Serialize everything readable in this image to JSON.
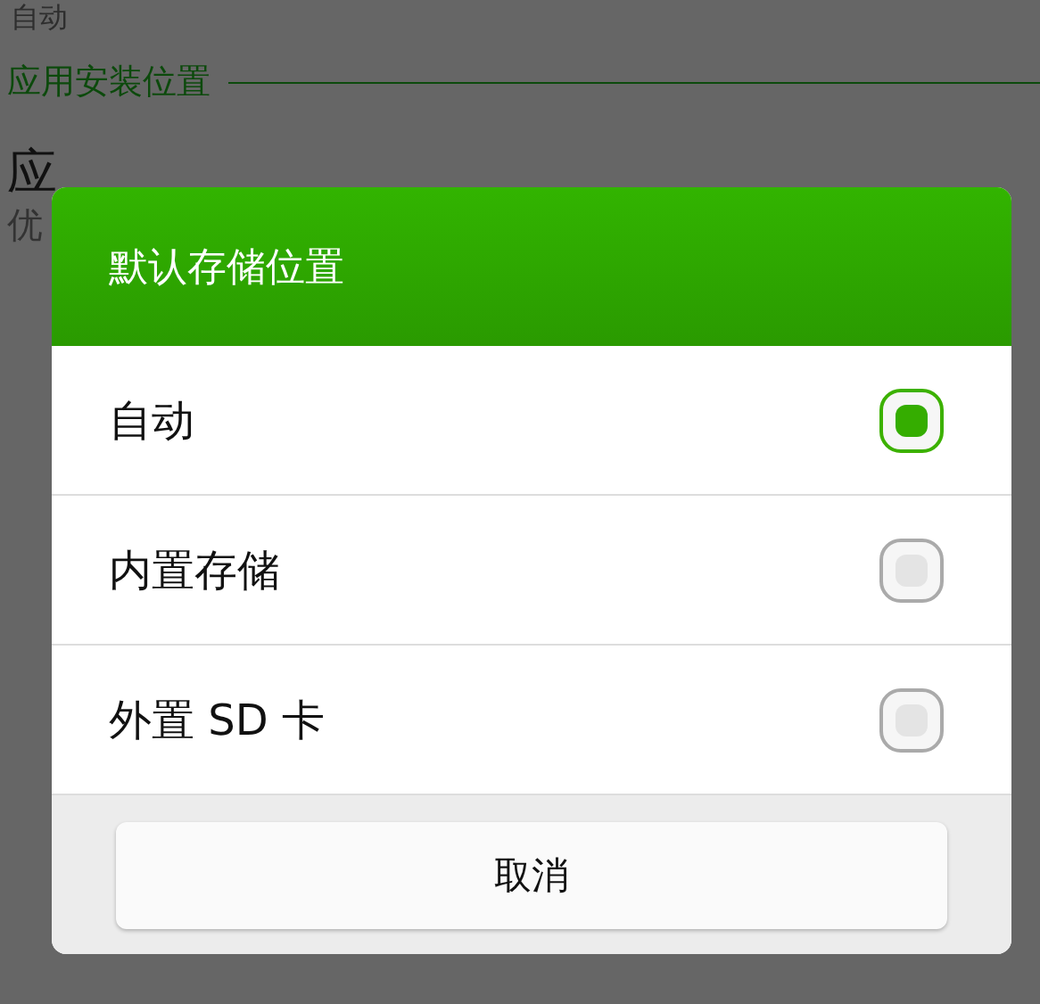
{
  "background": {
    "top_value": "自动",
    "section_header": "应用安装位置",
    "setting_title": "应",
    "setting_summary": "优"
  },
  "dialog": {
    "title": "默认存储位置",
    "options": [
      {
        "label": "自动",
        "selected": true
      },
      {
        "label": "内置存储",
        "selected": false
      },
      {
        "label": "外置 SD 卡",
        "selected": false
      }
    ],
    "cancel": "取消"
  }
}
